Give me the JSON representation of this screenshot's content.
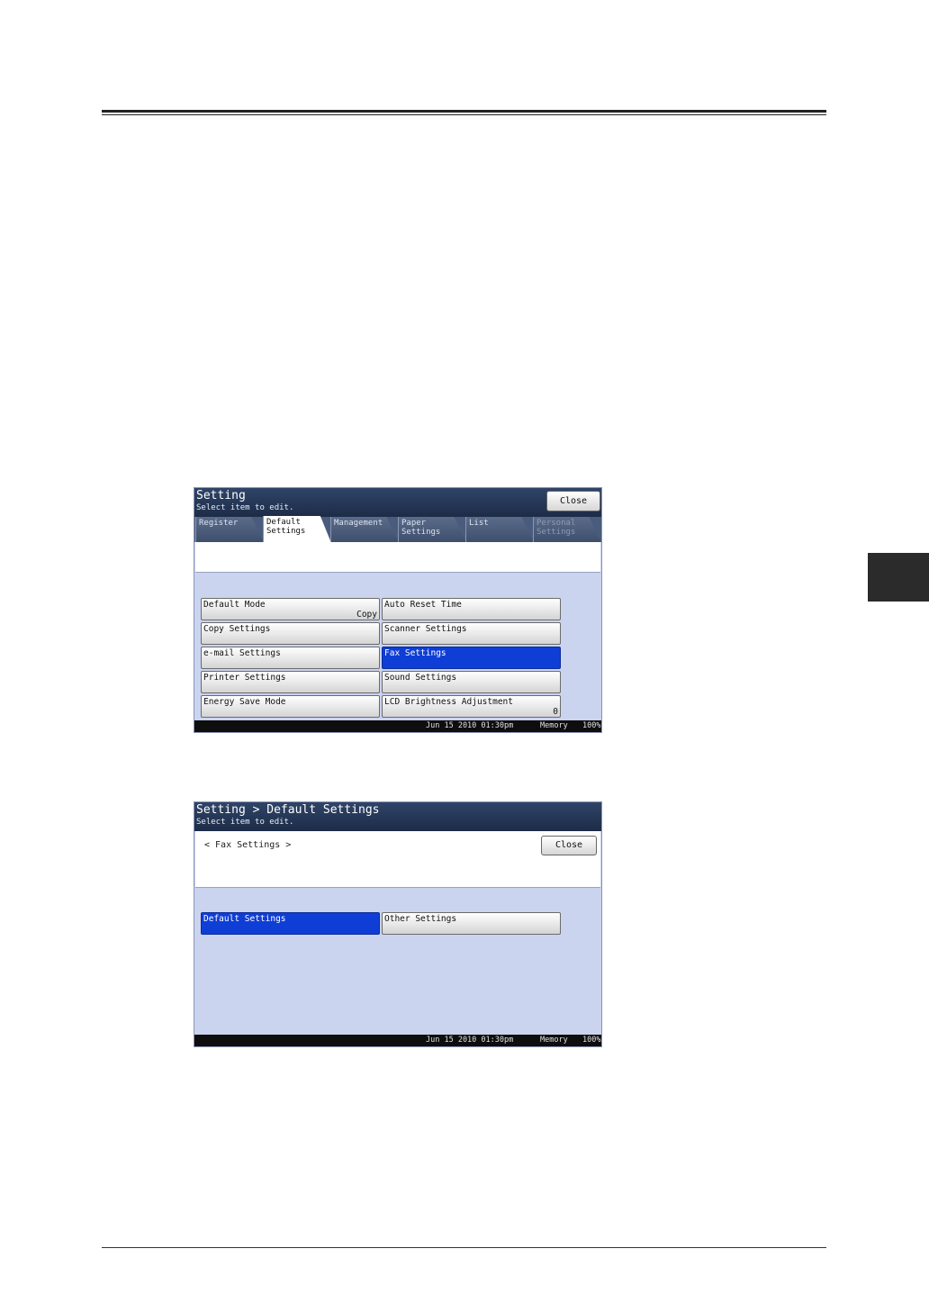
{
  "screen1": {
    "title": "Setting",
    "subtitle": "Select item to edit.",
    "close_label": "Close",
    "tabs": [
      {
        "label": "Register",
        "state": "normal"
      },
      {
        "label": "Default\nSettings",
        "state": "active"
      },
      {
        "label": "Management",
        "state": "normal"
      },
      {
        "label": "Paper\nSettings",
        "state": "normal"
      },
      {
        "label": "List",
        "state": "normal"
      },
      {
        "label": "Personal\nSettings",
        "state": "disabled"
      }
    ],
    "items": [
      {
        "label": "Default Mode",
        "value": "Copy"
      },
      {
        "label": "Auto Reset Time",
        "value": ""
      },
      {
        "label": "Copy Settings",
        "value": ""
      },
      {
        "label": "Scanner Settings",
        "value": ""
      },
      {
        "label": "e-mail Settings",
        "value": ""
      },
      {
        "label": "Fax Settings",
        "value": "",
        "selected": true
      },
      {
        "label": "Printer Settings",
        "value": ""
      },
      {
        "label": "Sound Settings",
        "value": ""
      },
      {
        "label": "Energy Save Mode",
        "value": ""
      },
      {
        "label": "LCD Brightness Adjustment",
        "value": "0"
      }
    ],
    "status": {
      "datetime": "Jun 15 2010 01:30pm",
      "memory_label": "Memory",
      "memory_value": "100%"
    }
  },
  "screen2": {
    "title": "Setting > Default Settings",
    "subtitle": "Select item to edit.",
    "crumb": "< Fax Settings >",
    "close_label": "Close",
    "items": [
      {
        "label": "Default Settings",
        "selected": true
      },
      {
        "label": "Other Settings"
      }
    ],
    "status": {
      "datetime": "Jun 15 2010 01:30pm",
      "memory_label": "Memory",
      "memory_value": "100%"
    }
  },
  "colors": {
    "selected": "#0f3ed6",
    "panel": "#cbd4ef",
    "titlebar": "#2f4468"
  }
}
